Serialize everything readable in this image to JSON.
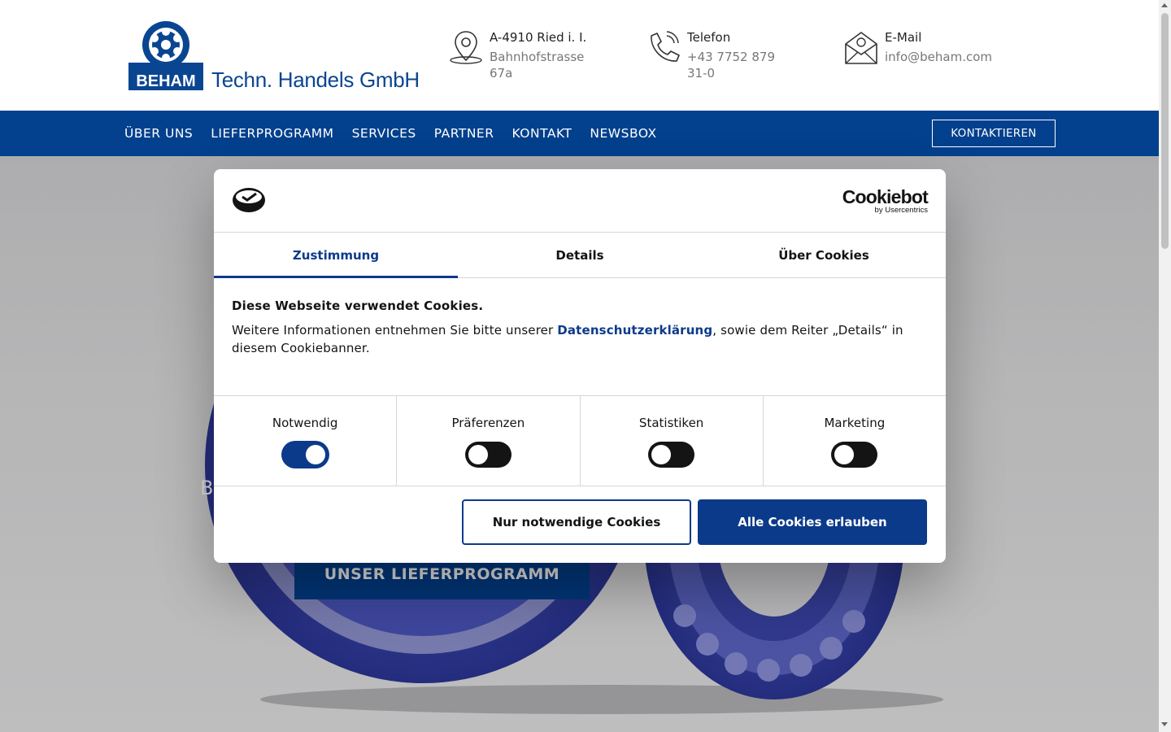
{
  "header": {
    "logo_badge": "BEHAM",
    "company": "Techn. Handels GmbH",
    "address": {
      "title": "A-4910 Ried i. I.",
      "line1": "Bahnhofstrasse",
      "line2": "67a"
    },
    "phone": {
      "title": "Telefon",
      "line1": "+43 7752 879",
      "line2": "31-0"
    },
    "email": {
      "title": "E-Mail",
      "line1": "info@beham.com"
    }
  },
  "nav": {
    "items": [
      "ÜBER UNS",
      "LIEFERPROGRAMM",
      "SERVICES",
      "PARTNER",
      "KONTAKT",
      "NEWSBOX"
    ],
    "cta": "KONTAKTIEREN",
    "color": "#03408d"
  },
  "hero": {
    "button": "UNSER LIEFERPROGRAMM",
    "partial_text": "B"
  },
  "cookie": {
    "brand": "Cookiebot",
    "brand_sub": "by Usercentrics",
    "tabs": [
      "Zustimmung",
      "Details",
      "Über Cookies"
    ],
    "active_tab": 0,
    "heading": "Diese Webseite verwendet Cookies.",
    "text_before": "Weitere Informationen entnehmen Sie bitte unserer ",
    "link": "Datenschutzerklärung",
    "text_after": ", sowie dem Reiter „Details“ in diesem Cookiebanner.",
    "toggles": [
      {
        "label": "Notwendig",
        "on": true
      },
      {
        "label": "Präferenzen",
        "on": false
      },
      {
        "label": "Statistiken",
        "on": false
      },
      {
        "label": "Marketing",
        "on": false
      }
    ],
    "btn_necessary": "Nur notwendige Cookies",
    "btn_all": "Alle Cookies erlauben",
    "accent": "#0c3a8a"
  }
}
